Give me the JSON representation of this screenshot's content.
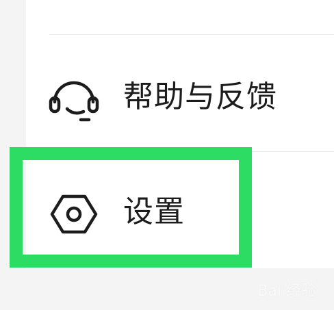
{
  "menu": {
    "help": {
      "label": "帮助与反馈",
      "icon": "headset-icon"
    },
    "settings": {
      "label": "设置",
      "icon": "hexagon-nut-icon"
    }
  },
  "highlight": {
    "color": "#2ddd63"
  },
  "watermark": {
    "text": "Bai 经验"
  }
}
